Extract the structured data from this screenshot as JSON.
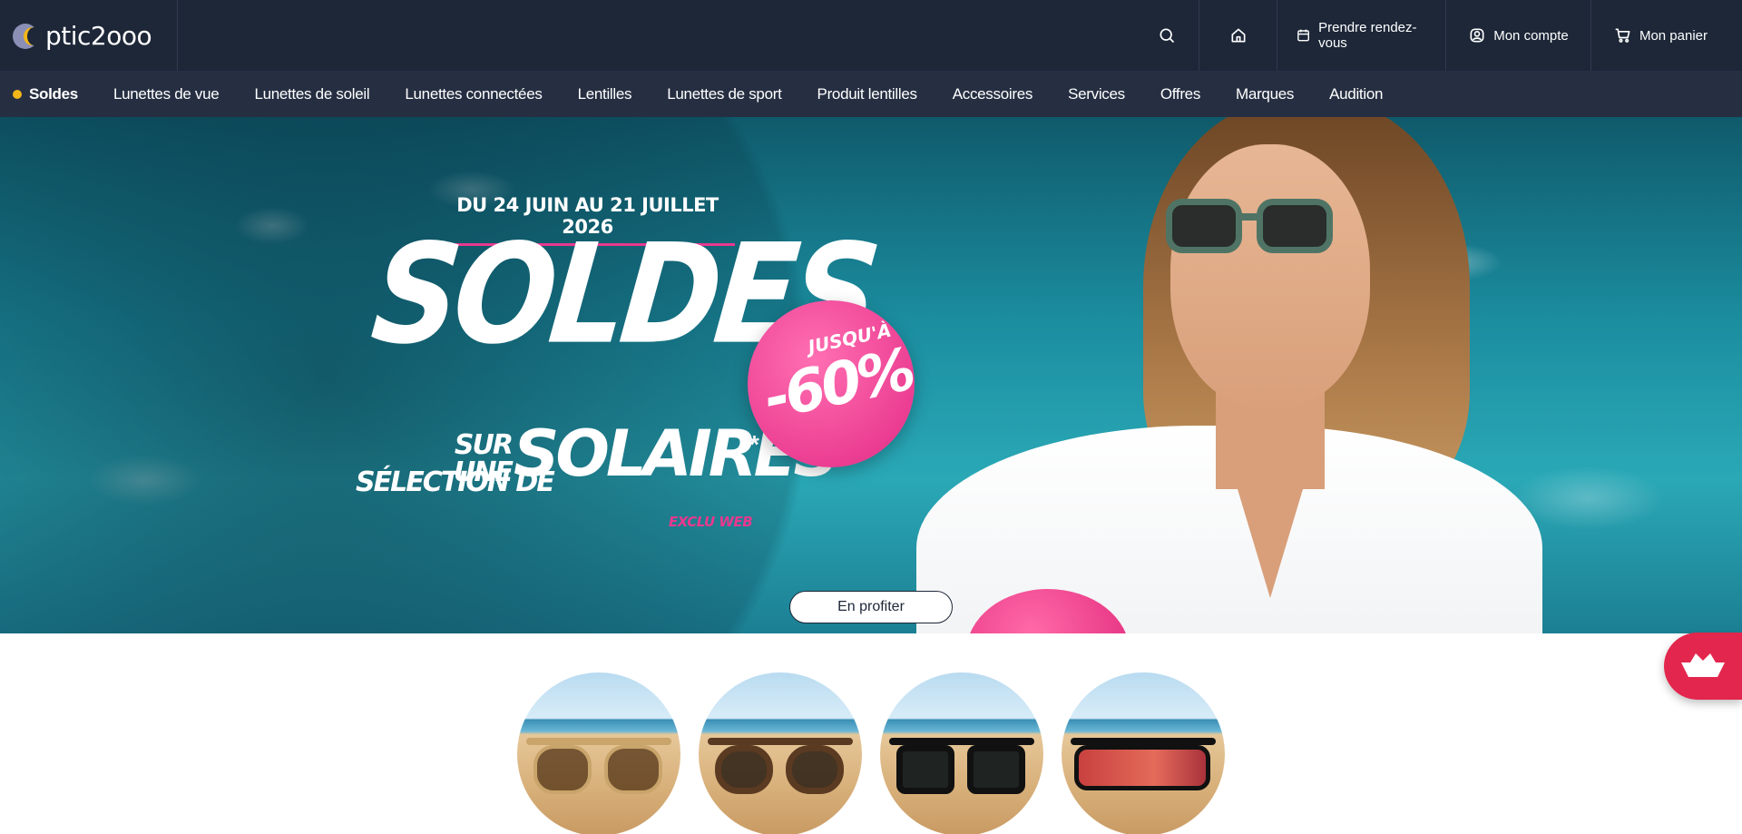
{
  "header": {
    "logo_text": "ptic2ooo",
    "links": {
      "appointment": "Prendre rendez-vous",
      "account": "Mon compte",
      "cart": "Mon panier"
    },
    "icons": [
      "search-icon",
      "home-icon",
      "calendar-icon",
      "account-icon",
      "cart-icon"
    ]
  },
  "nav": {
    "items": [
      {
        "label": "Soldes",
        "active": true
      },
      {
        "label": "Lunettes de vue"
      },
      {
        "label": "Lunettes de soleil"
      },
      {
        "label": "Lunettes connectées"
      },
      {
        "label": "Lentilles"
      },
      {
        "label": "Lunettes de sport"
      },
      {
        "label": "Produit lentilles"
      },
      {
        "label": "Accessoires"
      },
      {
        "label": "Services"
      },
      {
        "label": "Offres"
      },
      {
        "label": "Marques"
      },
      {
        "label": "Audition"
      }
    ],
    "active_dot_color": "#f2b619"
  },
  "hero": {
    "date_range": "DU 24 JUIN AU 21 JUILLET 2026",
    "title": "SOLDES",
    "line_sur_une": "SUR UNE",
    "line_selection_de": "SÉLECTION DE",
    "line_solaires": "SOLAIRES",
    "asterisk": "*",
    "exclu": "EXCLU WEB",
    "badge_top": "JUSQU'À",
    "badge_value": "-60%",
    "cta_label": "En profiter",
    "accent_color": "#e8388f"
  },
  "categories": {
    "items": [
      {
        "name": "sunglasses-round-gold"
      },
      {
        "name": "sunglasses-tortoise"
      },
      {
        "name": "sunglasses-black-square"
      },
      {
        "name": "sunglasses-sport-mask"
      }
    ]
  },
  "chat_button": {
    "icon": "boat-icon",
    "color": "#e3264d"
  },
  "colors": {
    "header_bg": "#1d2738",
    "nav_bg": "#262f42"
  }
}
